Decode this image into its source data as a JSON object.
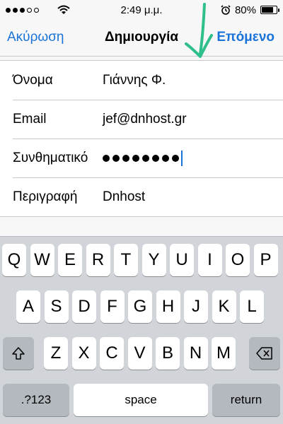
{
  "status": {
    "signal_dots_filled": 3,
    "signal_dots_total": 5,
    "time": "2:49 μ.μ.",
    "battery": "80%",
    "battery_level": 0.8
  },
  "nav": {
    "cancel_label": "Ακύρωση",
    "title": "Δημιουργία",
    "next_label": "Επόμενο"
  },
  "form": {
    "rows": [
      {
        "label": "Όνομα",
        "value": "Γιάννης Φ."
      },
      {
        "label": "Email",
        "value": "jef@dnhost.gr"
      },
      {
        "label": "Συνθηματικό",
        "password_length": 8
      },
      {
        "label": "Περιγραφή",
        "value": "Dnhost"
      }
    ]
  },
  "keyboard": {
    "row1": [
      "Q",
      "W",
      "E",
      "R",
      "T",
      "Y",
      "U",
      "I",
      "O",
      "P"
    ],
    "row2": [
      "A",
      "S",
      "D",
      "F",
      "G",
      "H",
      "J",
      "K",
      "L"
    ],
    "row3": [
      "Z",
      "X",
      "C",
      "V",
      "B",
      "N",
      "M"
    ],
    "numbers_label": ".?123",
    "space_label": "space",
    "return_label": "return"
  },
  "colors": {
    "accent": "#1a73d9",
    "annotation": "#2fbf8a"
  }
}
